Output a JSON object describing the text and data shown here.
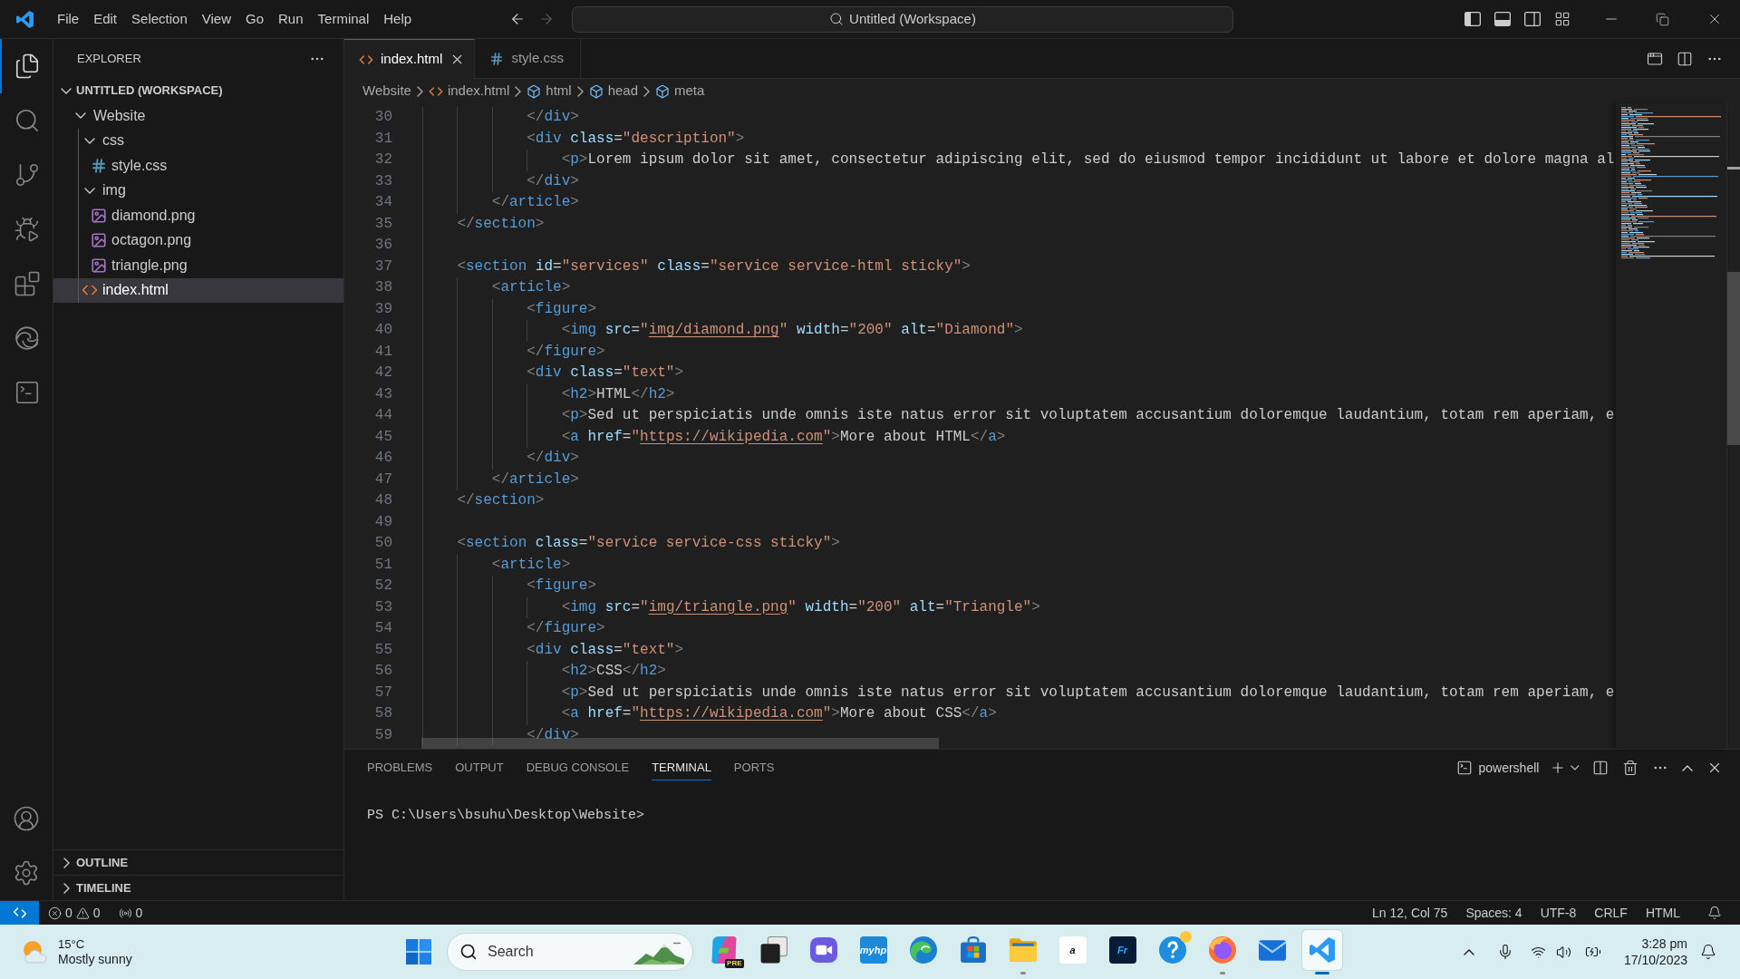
{
  "title_bar": {
    "menu": [
      "File",
      "Edit",
      "Selection",
      "View",
      "Go",
      "Run",
      "Terminal",
      "Help"
    ],
    "back": {
      "disabled": false
    },
    "forward": {
      "disabled": true
    },
    "command_center": "Untitled (Workspace)",
    "layout_toggles": [
      {
        "on": true
      },
      {
        "on": true
      },
      {
        "on": false
      }
    ]
  },
  "activity_bar": [
    {
      "kind": "explorer",
      "selected": true
    },
    {
      "kind": "search",
      "selected": false
    },
    {
      "kind": "source-control",
      "selected": false
    },
    {
      "kind": "run-debug",
      "selected": false
    },
    {
      "kind": "extensions",
      "selected": false
    },
    {
      "kind": "browser",
      "selected": false
    },
    {
      "kind": "terminal",
      "selected": false
    }
  ],
  "explorer": {
    "title": "EXPLORER",
    "workspace": {
      "title": "UNTITLED (WORKSPACE)",
      "expanded": true,
      "tree": [
        {
          "label": "Website",
          "kind": "folder",
          "expanded": true,
          "selected": false,
          "children": [
            {
              "label": "css",
              "kind": "folder",
              "expanded": true,
              "selected": false,
              "children": [
                {
                  "label": "style.css",
                  "kind": "css",
                  "selected": false
                }
              ]
            },
            {
              "label": "img",
              "kind": "folder",
              "expanded": true,
              "selected": false,
              "children": [
                {
                  "label": "diamond.png",
                  "kind": "image",
                  "selected": false
                },
                {
                  "label": "octagon.png",
                  "kind": "image",
                  "selected": false
                },
                {
                  "label": "triangle.png",
                  "kind": "image",
                  "selected": false
                }
              ]
            },
            {
              "label": "index.html",
              "kind": "html",
              "selected": true
            }
          ]
        }
      ]
    },
    "sections": [
      {
        "title": "OUTLINE",
        "expanded": false
      },
      {
        "title": "TIMELINE",
        "expanded": false
      }
    ]
  },
  "editor": {
    "tabs": [
      {
        "label": "index.html",
        "kind": "html",
        "selected": true
      },
      {
        "label": "style.css",
        "kind": "css",
        "selected": false
      }
    ],
    "breadcrumb": [
      {
        "label": "Website",
        "kind": "folder"
      },
      {
        "label": "index.html",
        "kind": "html"
      },
      {
        "label": "html",
        "kind": "element"
      },
      {
        "label": "head",
        "kind": "element"
      },
      {
        "label": "meta",
        "kind": "element"
      }
    ],
    "lines": [
      {
        "number": "30",
        "tokens": [
          {
            "kind": "punct",
            "text": "            </"
          },
          {
            "kind": "tag",
            "text": "div"
          },
          {
            "kind": "punct",
            "text": ">"
          }
        ]
      },
      {
        "number": "31",
        "tokens": [
          {
            "kind": "punct",
            "text": "            <"
          },
          {
            "kind": "tag",
            "text": "div"
          },
          {
            "kind": "attr",
            "text": " class"
          },
          {
            "kind": "eq",
            "text": "="
          },
          {
            "kind": "string",
            "text": "\"description\""
          },
          {
            "kind": "punct",
            "text": ">"
          }
        ]
      },
      {
        "number": "32",
        "tokens": [
          {
            "kind": "punct",
            "text": "                <"
          },
          {
            "kind": "tag",
            "text": "p"
          },
          {
            "kind": "punct",
            "text": ">"
          },
          {
            "kind": "text",
            "text": "Lorem ipsum dolor sit amet, consectetur adipiscing elit, sed do eiusmod tempor incididunt ut labore et dolore magna al"
          }
        ]
      },
      {
        "number": "33",
        "tokens": [
          {
            "kind": "punct",
            "text": "            </"
          },
          {
            "kind": "tag",
            "text": "div"
          },
          {
            "kind": "punct",
            "text": ">"
          }
        ]
      },
      {
        "number": "34",
        "tokens": [
          {
            "kind": "punct",
            "text": "        </"
          },
          {
            "kind": "tag",
            "text": "article"
          },
          {
            "kind": "punct",
            "text": ">"
          }
        ]
      },
      {
        "number": "35",
        "tokens": [
          {
            "kind": "punct",
            "text": "    </"
          },
          {
            "kind": "tag",
            "text": "section"
          },
          {
            "kind": "punct",
            "text": ">"
          }
        ]
      },
      {
        "number": "36"
      },
      {
        "number": "37",
        "tokens": [
          {
            "kind": "punct",
            "text": "    <"
          },
          {
            "kind": "tag",
            "text": "section"
          },
          {
            "kind": "attr",
            "text": " id"
          },
          {
            "kind": "eq",
            "text": "="
          },
          {
            "kind": "string",
            "text": "\"services\""
          },
          {
            "kind": "attr",
            "text": " class"
          },
          {
            "kind": "eq",
            "text": "="
          },
          {
            "kind": "string",
            "text": "\"service service-html sticky\""
          },
          {
            "kind": "punct",
            "text": ">"
          }
        ]
      },
      {
        "number": "38",
        "tokens": [
          {
            "kind": "punct",
            "text": "        <"
          },
          {
            "kind": "tag",
            "text": "article"
          },
          {
            "kind": "punct",
            "text": ">"
          }
        ]
      },
      {
        "number": "39",
        "tokens": [
          {
            "kind": "punct",
            "text": "            <"
          },
          {
            "kind": "tag",
            "text": "figure"
          },
          {
            "kind": "punct",
            "text": ">"
          }
        ]
      },
      {
        "number": "40",
        "tokens": [
          {
            "kind": "punct",
            "text": "                <"
          },
          {
            "kind": "tag",
            "text": "img"
          },
          {
            "kind": "attr",
            "text": " src"
          },
          {
            "kind": "eq",
            "text": "="
          },
          {
            "kind": "string",
            "text": "\""
          },
          {
            "kind": "link",
            "text": "img/diamond.png"
          },
          {
            "kind": "string",
            "text": "\""
          },
          {
            "kind": "attr",
            "text": " width"
          },
          {
            "kind": "eq",
            "text": "="
          },
          {
            "kind": "string",
            "text": "\"200\""
          },
          {
            "kind": "attr",
            "text": " alt"
          },
          {
            "kind": "eq",
            "text": "="
          },
          {
            "kind": "string",
            "text": "\"Diamond\""
          },
          {
            "kind": "punct",
            "text": ">"
          }
        ]
      },
      {
        "number": "41",
        "tokens": [
          {
            "kind": "punct",
            "text": "            </"
          },
          {
            "kind": "tag",
            "text": "figure"
          },
          {
            "kind": "punct",
            "text": ">"
          }
        ]
      },
      {
        "number": "42",
        "tokens": [
          {
            "kind": "punct",
            "text": "            <"
          },
          {
            "kind": "tag",
            "text": "div"
          },
          {
            "kind": "attr",
            "text": " class"
          },
          {
            "kind": "eq",
            "text": "="
          },
          {
            "kind": "string",
            "text": "\"text\""
          },
          {
            "kind": "punct",
            "text": ">"
          }
        ]
      },
      {
        "number": "43",
        "tokens": [
          {
            "kind": "punct",
            "text": "                <"
          },
          {
            "kind": "tag",
            "text": "h2"
          },
          {
            "kind": "punct",
            "text": ">"
          },
          {
            "kind": "text",
            "text": "HTML"
          },
          {
            "kind": "punct",
            "text": "</"
          },
          {
            "kind": "tag",
            "text": "h2"
          },
          {
            "kind": "punct",
            "text": ">"
          }
        ]
      },
      {
        "number": "44",
        "tokens": [
          {
            "kind": "punct",
            "text": "                <"
          },
          {
            "kind": "tag",
            "text": "p"
          },
          {
            "kind": "punct",
            "text": ">"
          },
          {
            "kind": "text",
            "text": "Sed ut perspiciatis unde omnis iste natus error sit voluptatem accusantium doloremque laudantium, totam rem aperiam, e"
          }
        ]
      },
      {
        "number": "45",
        "tokens": [
          {
            "kind": "punct",
            "text": "                <"
          },
          {
            "kind": "tag",
            "text": "a"
          },
          {
            "kind": "attr",
            "text": " href"
          },
          {
            "kind": "eq",
            "text": "="
          },
          {
            "kind": "string",
            "text": "\""
          },
          {
            "kind": "link",
            "text": "https://wikipedia.com"
          },
          {
            "kind": "string",
            "text": "\""
          },
          {
            "kind": "punct",
            "text": ">"
          },
          {
            "kind": "text",
            "text": "More about HTML"
          },
          {
            "kind": "punct",
            "text": "</"
          },
          {
            "kind": "tag",
            "text": "a"
          },
          {
            "kind": "punct",
            "text": ">"
          }
        ]
      },
      {
        "number": "46",
        "tokens": [
          {
            "kind": "punct",
            "text": "            </"
          },
          {
            "kind": "tag",
            "text": "div"
          },
          {
            "kind": "punct",
            "text": ">"
          }
        ]
      },
      {
        "number": "47",
        "tokens": [
          {
            "kind": "punct",
            "text": "        </"
          },
          {
            "kind": "tag",
            "text": "article"
          },
          {
            "kind": "punct",
            "text": ">"
          }
        ]
      },
      {
        "number": "48",
        "tokens": [
          {
            "kind": "punct",
            "text": "    </"
          },
          {
            "kind": "tag",
            "text": "section"
          },
          {
            "kind": "punct",
            "text": ">"
          }
        ]
      },
      {
        "number": "49"
      },
      {
        "number": "50",
        "tokens": [
          {
            "kind": "punct",
            "text": "    <"
          },
          {
            "kind": "tag",
            "text": "section"
          },
          {
            "kind": "attr",
            "text": " class"
          },
          {
            "kind": "eq",
            "text": "="
          },
          {
            "kind": "string",
            "text": "\"service service-css sticky\""
          },
          {
            "kind": "punct",
            "text": ">"
          }
        ]
      },
      {
        "number": "51",
        "tokens": [
          {
            "kind": "punct",
            "text": "        <"
          },
          {
            "kind": "tag",
            "text": "article"
          },
          {
            "kind": "punct",
            "text": ">"
          }
        ]
      },
      {
        "number": "52",
        "tokens": [
          {
            "kind": "punct",
            "text": "            <"
          },
          {
            "kind": "tag",
            "text": "figure"
          },
          {
            "kind": "punct",
            "text": ">"
          }
        ]
      },
      {
        "number": "53",
        "tokens": [
          {
            "kind": "punct",
            "text": "                <"
          },
          {
            "kind": "tag",
            "text": "img"
          },
          {
            "kind": "attr",
            "text": " src"
          },
          {
            "kind": "eq",
            "text": "="
          },
          {
            "kind": "string",
            "text": "\""
          },
          {
            "kind": "link",
            "text": "img/triangle.png"
          },
          {
            "kind": "string",
            "text": "\""
          },
          {
            "kind": "attr",
            "text": " width"
          },
          {
            "kind": "eq",
            "text": "="
          },
          {
            "kind": "string",
            "text": "\"200\""
          },
          {
            "kind": "attr",
            "text": " alt"
          },
          {
            "kind": "eq",
            "text": "="
          },
          {
            "kind": "string",
            "text": "\"Triangle\""
          },
          {
            "kind": "punct",
            "text": ">"
          }
        ]
      },
      {
        "number": "54",
        "tokens": [
          {
            "kind": "punct",
            "text": "            </"
          },
          {
            "kind": "tag",
            "text": "figure"
          },
          {
            "kind": "punct",
            "text": ">"
          }
        ]
      },
      {
        "number": "55",
        "tokens": [
          {
            "kind": "punct",
            "text": "            <"
          },
          {
            "kind": "tag",
            "text": "div"
          },
          {
            "kind": "attr",
            "text": " class"
          },
          {
            "kind": "eq",
            "text": "="
          },
          {
            "kind": "string",
            "text": "\"text\""
          },
          {
            "kind": "punct",
            "text": ">"
          }
        ]
      },
      {
        "number": "56",
        "tokens": [
          {
            "kind": "punct",
            "text": "                <"
          },
          {
            "kind": "tag",
            "text": "h2"
          },
          {
            "kind": "punct",
            "text": ">"
          },
          {
            "kind": "text",
            "text": "CSS"
          },
          {
            "kind": "punct",
            "text": "</"
          },
          {
            "kind": "tag",
            "text": "h2"
          },
          {
            "kind": "punct",
            "text": ">"
          }
        ]
      },
      {
        "number": "57",
        "tokens": [
          {
            "kind": "punct",
            "text": "                <"
          },
          {
            "kind": "tag",
            "text": "p"
          },
          {
            "kind": "punct",
            "text": ">"
          },
          {
            "kind": "text",
            "text": "Sed ut perspiciatis unde omnis iste natus error sit voluptatem accusantium doloremque laudantium, totam rem aperiam, e"
          }
        ]
      },
      {
        "number": "58",
        "tokens": [
          {
            "kind": "punct",
            "text": "                <"
          },
          {
            "kind": "tag",
            "text": "a"
          },
          {
            "kind": "attr",
            "text": " href"
          },
          {
            "kind": "eq",
            "text": "="
          },
          {
            "kind": "string",
            "text": "\""
          },
          {
            "kind": "link",
            "text": "https://wikipedia.com"
          },
          {
            "kind": "string",
            "text": "\""
          },
          {
            "kind": "punct",
            "text": ">"
          },
          {
            "kind": "text",
            "text": "More about CSS"
          },
          {
            "kind": "punct",
            "text": "</"
          },
          {
            "kind": "tag",
            "text": "a"
          },
          {
            "kind": "punct",
            "text": ">"
          }
        ]
      },
      {
        "number": "59",
        "tokens": [
          {
            "kind": "punct",
            "text": "            </"
          },
          {
            "kind": "tag",
            "text": "div"
          },
          {
            "kind": "punct",
            "text": ">"
          }
        ]
      }
    ]
  },
  "panel": {
    "tabs": [
      {
        "label": "PROBLEMS",
        "selected": false
      },
      {
        "label": "OUTPUT",
        "selected": false
      },
      {
        "label": "DEBUG CONSOLE",
        "selected": false
      },
      {
        "label": "TERMINAL",
        "selected": true
      },
      {
        "label": "PORTS",
        "selected": false
      }
    ],
    "terminal_profile": "powershell",
    "terminal_lines": [
      "PS C:\\Users\\bsuhu\\Desktop\\Website>"
    ]
  },
  "status_bar": {
    "errors": "0",
    "warnings": "0",
    "ports": "0",
    "position": "Ln 12, Col 75",
    "indentation": "Spaces: 4",
    "encoding": "UTF-8",
    "line_ending": "CRLF",
    "language": "HTML"
  },
  "taskbar": {
    "weather": {
      "temperature": "15°C",
      "condition": "Mostly sunny"
    },
    "search": {
      "placeholder": "Search"
    },
    "apps": [
      {
        "kind": "knot",
        "badge": "PRE",
        "badge_dot": false,
        "running": false,
        "selected": false
      },
      {
        "kind": "stack",
        "badge_dot": false,
        "running": false,
        "selected": false
      },
      {
        "kind": "camera",
        "badge_dot": false,
        "running": false,
        "selected": false
      },
      {
        "kind": "tile",
        "label": "myhp",
        "color": "#1c8ad8",
        "badge_dot": false,
        "running": false,
        "selected": false
      },
      {
        "kind": "swirl",
        "badge_dot": false,
        "running": false,
        "selected": false
      },
      {
        "kind": "bag",
        "badge_dot": false,
        "running": false,
        "selected": false
      },
      {
        "kind": "folder",
        "badge_dot": false,
        "running": true,
        "selected": false
      },
      {
        "kind": "tile",
        "label": "a",
        "color": "#ffffff",
        "badge_dot": false,
        "running": false,
        "selected": false
      },
      {
        "kind": "tile",
        "label": "Fr",
        "color": "#061b36",
        "badge_dot": false,
        "running": false,
        "selected": false
      },
      {
        "kind": "help",
        "badge_dot": true,
        "running": false,
        "selected": false
      },
      {
        "kind": "flame",
        "badge_dot": false,
        "running": true,
        "selected": false
      },
      {
        "kind": "mail",
        "badge_dot": false,
        "running": false,
        "selected": false
      },
      {
        "kind": "ribbon",
        "badge_dot": false,
        "running": true,
        "selected": true
      }
    ],
    "clock": {
      "time": "3:28 pm",
      "date": "17/10/2023"
    }
  }
}
